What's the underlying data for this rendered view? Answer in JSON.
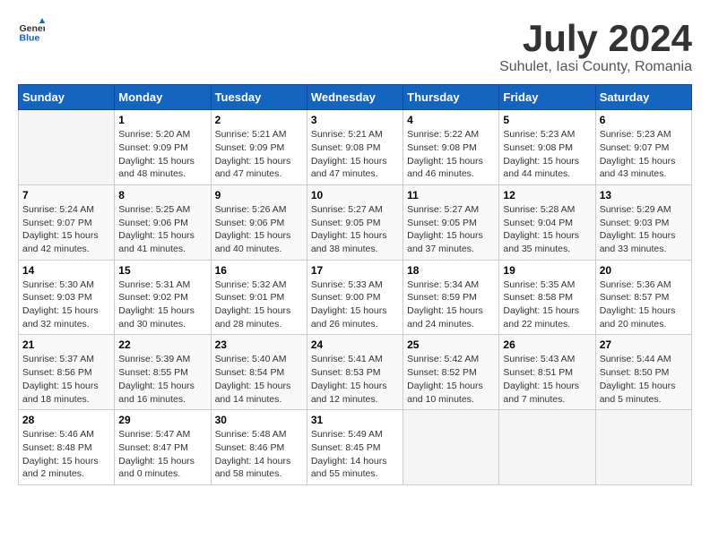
{
  "header": {
    "logo_general": "General",
    "logo_blue": "Blue",
    "title": "July 2024",
    "subtitle": "Suhulet, Iasi County, Romania"
  },
  "calendar": {
    "days_of_week": [
      "Sunday",
      "Monday",
      "Tuesday",
      "Wednesday",
      "Thursday",
      "Friday",
      "Saturday"
    ],
    "weeks": [
      [
        {
          "day": "",
          "info": ""
        },
        {
          "day": "1",
          "info": "Sunrise: 5:20 AM\nSunset: 9:09 PM\nDaylight: 15 hours\nand 48 minutes."
        },
        {
          "day": "2",
          "info": "Sunrise: 5:21 AM\nSunset: 9:09 PM\nDaylight: 15 hours\nand 47 minutes."
        },
        {
          "day": "3",
          "info": "Sunrise: 5:21 AM\nSunset: 9:08 PM\nDaylight: 15 hours\nand 47 minutes."
        },
        {
          "day": "4",
          "info": "Sunrise: 5:22 AM\nSunset: 9:08 PM\nDaylight: 15 hours\nand 46 minutes."
        },
        {
          "day": "5",
          "info": "Sunrise: 5:23 AM\nSunset: 9:08 PM\nDaylight: 15 hours\nand 44 minutes."
        },
        {
          "day": "6",
          "info": "Sunrise: 5:23 AM\nSunset: 9:07 PM\nDaylight: 15 hours\nand 43 minutes."
        }
      ],
      [
        {
          "day": "7",
          "info": "Sunrise: 5:24 AM\nSunset: 9:07 PM\nDaylight: 15 hours\nand 42 minutes."
        },
        {
          "day": "8",
          "info": "Sunrise: 5:25 AM\nSunset: 9:06 PM\nDaylight: 15 hours\nand 41 minutes."
        },
        {
          "day": "9",
          "info": "Sunrise: 5:26 AM\nSunset: 9:06 PM\nDaylight: 15 hours\nand 40 minutes."
        },
        {
          "day": "10",
          "info": "Sunrise: 5:27 AM\nSunset: 9:05 PM\nDaylight: 15 hours\nand 38 minutes."
        },
        {
          "day": "11",
          "info": "Sunrise: 5:27 AM\nSunset: 9:05 PM\nDaylight: 15 hours\nand 37 minutes."
        },
        {
          "day": "12",
          "info": "Sunrise: 5:28 AM\nSunset: 9:04 PM\nDaylight: 15 hours\nand 35 minutes."
        },
        {
          "day": "13",
          "info": "Sunrise: 5:29 AM\nSunset: 9:03 PM\nDaylight: 15 hours\nand 33 minutes."
        }
      ],
      [
        {
          "day": "14",
          "info": "Sunrise: 5:30 AM\nSunset: 9:03 PM\nDaylight: 15 hours\nand 32 minutes."
        },
        {
          "day": "15",
          "info": "Sunrise: 5:31 AM\nSunset: 9:02 PM\nDaylight: 15 hours\nand 30 minutes."
        },
        {
          "day": "16",
          "info": "Sunrise: 5:32 AM\nSunset: 9:01 PM\nDaylight: 15 hours\nand 28 minutes."
        },
        {
          "day": "17",
          "info": "Sunrise: 5:33 AM\nSunset: 9:00 PM\nDaylight: 15 hours\nand 26 minutes."
        },
        {
          "day": "18",
          "info": "Sunrise: 5:34 AM\nSunset: 8:59 PM\nDaylight: 15 hours\nand 24 minutes."
        },
        {
          "day": "19",
          "info": "Sunrise: 5:35 AM\nSunset: 8:58 PM\nDaylight: 15 hours\nand 22 minutes."
        },
        {
          "day": "20",
          "info": "Sunrise: 5:36 AM\nSunset: 8:57 PM\nDaylight: 15 hours\nand 20 minutes."
        }
      ],
      [
        {
          "day": "21",
          "info": "Sunrise: 5:37 AM\nSunset: 8:56 PM\nDaylight: 15 hours\nand 18 minutes."
        },
        {
          "day": "22",
          "info": "Sunrise: 5:39 AM\nSunset: 8:55 PM\nDaylight: 15 hours\nand 16 minutes."
        },
        {
          "day": "23",
          "info": "Sunrise: 5:40 AM\nSunset: 8:54 PM\nDaylight: 15 hours\nand 14 minutes."
        },
        {
          "day": "24",
          "info": "Sunrise: 5:41 AM\nSunset: 8:53 PM\nDaylight: 15 hours\nand 12 minutes."
        },
        {
          "day": "25",
          "info": "Sunrise: 5:42 AM\nSunset: 8:52 PM\nDaylight: 15 hours\nand 10 minutes."
        },
        {
          "day": "26",
          "info": "Sunrise: 5:43 AM\nSunset: 8:51 PM\nDaylight: 15 hours\nand 7 minutes."
        },
        {
          "day": "27",
          "info": "Sunrise: 5:44 AM\nSunset: 8:50 PM\nDaylight: 15 hours\nand 5 minutes."
        }
      ],
      [
        {
          "day": "28",
          "info": "Sunrise: 5:46 AM\nSunset: 8:48 PM\nDaylight: 15 hours\nand 2 minutes."
        },
        {
          "day": "29",
          "info": "Sunrise: 5:47 AM\nSunset: 8:47 PM\nDaylight: 15 hours\nand 0 minutes."
        },
        {
          "day": "30",
          "info": "Sunrise: 5:48 AM\nSunset: 8:46 PM\nDaylight: 14 hours\nand 58 minutes."
        },
        {
          "day": "31",
          "info": "Sunrise: 5:49 AM\nSunset: 8:45 PM\nDaylight: 14 hours\nand 55 minutes."
        },
        {
          "day": "",
          "info": ""
        },
        {
          "day": "",
          "info": ""
        },
        {
          "day": "",
          "info": ""
        }
      ]
    ]
  }
}
